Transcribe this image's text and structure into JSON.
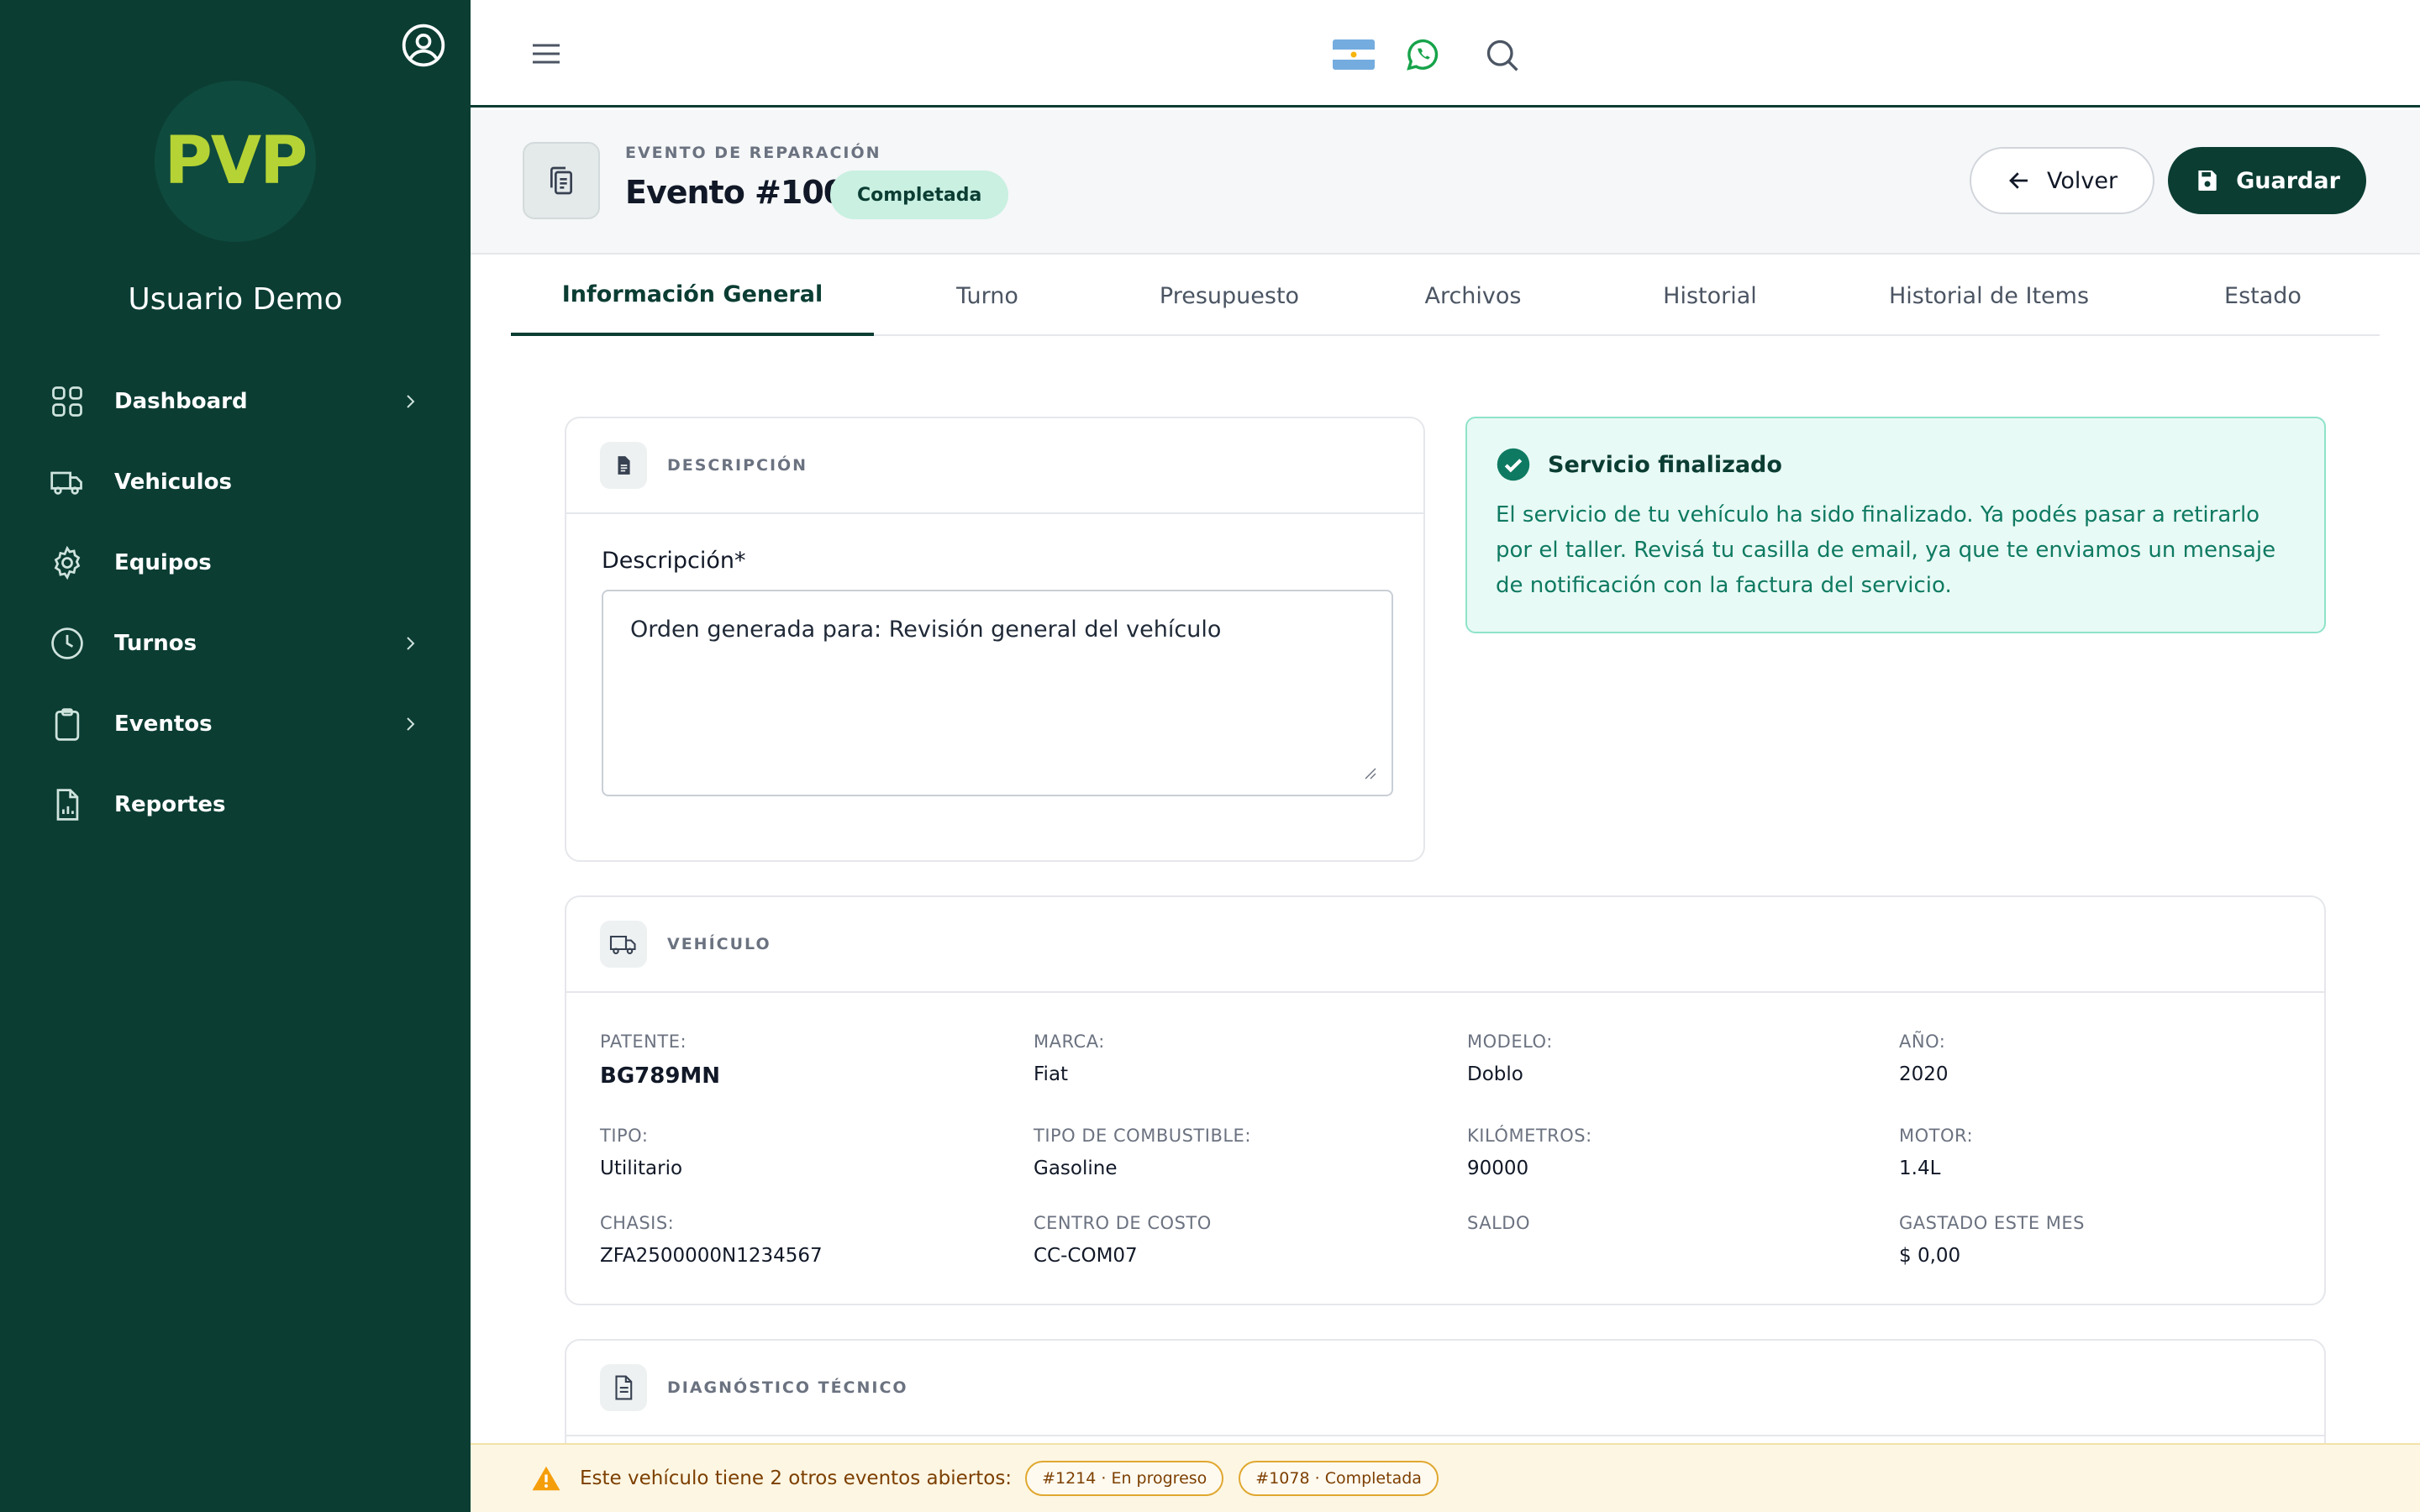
{
  "sidebar": {
    "logo": "PVP",
    "username": "Usuario Demo",
    "items": [
      {
        "label": "Dashboard",
        "icon": "grid-icon",
        "has_chevron": true
      },
      {
        "label": "Vehiculos",
        "icon": "truck-icon",
        "has_chevron": false
      },
      {
        "label": "Equipos",
        "icon": "gear-icon",
        "has_chevron": false
      },
      {
        "label": "Turnos",
        "icon": "clock-icon",
        "has_chevron": true
      },
      {
        "label": "Eventos",
        "icon": "clipboard-icon",
        "has_chevron": true
      },
      {
        "label": "Reportes",
        "icon": "report-icon",
        "has_chevron": false
      }
    ]
  },
  "topbar": {
    "icons": [
      "menu-icon",
      "argentina-flag-icon",
      "whatsapp-icon",
      "search-icon"
    ]
  },
  "header": {
    "eyebrow": "EVENTO DE REPARACIÓN",
    "title": "Evento #1004",
    "status_badge": "Completada",
    "back_label": "Volver",
    "save_label": "Guardar"
  },
  "tabs": [
    {
      "label": "Información General",
      "active": true
    },
    {
      "label": "Turno",
      "active": false
    },
    {
      "label": "Presupuesto",
      "active": false
    },
    {
      "label": "Archivos",
      "active": false
    },
    {
      "label": "Historial",
      "active": false
    },
    {
      "label": "Historial de Items",
      "active": false
    },
    {
      "label": "Estado",
      "active": false
    }
  ],
  "description_card": {
    "title": "DESCRIPCIÓN",
    "field_label": "Descripción*",
    "value": "Orden generada para: Revisión general del vehículo"
  },
  "alert": {
    "title": "Servicio finalizado",
    "body": "El servicio de tu vehículo ha sido finalizado. Ya podés pasar a retirarlo por el taller. Revisá tu casilla de email, ya que te enviamos un mensaje de notificación con la factura del servicio."
  },
  "vehicle_card": {
    "title": "VEHÍCULO",
    "fields": [
      {
        "key": "PATENTE:",
        "value": "BG789MN"
      },
      {
        "key": "MARCA:",
        "value": "Fiat"
      },
      {
        "key": "MODELO:",
        "value": "Doblo"
      },
      {
        "key": "AÑO:",
        "value": "2020"
      },
      {
        "key": "TIPO:",
        "value": "Utilitario"
      },
      {
        "key": "TIPO DE COMBUSTIBLE:",
        "value": "Gasoline"
      },
      {
        "key": "KILÓMETROS:",
        "value": "90000"
      },
      {
        "key": "MOTOR:",
        "value": "1.4L"
      },
      {
        "key": "CHASIS:",
        "value": "ZFA2500000N1234567"
      },
      {
        "key": "CENTRO DE COSTO",
        "value": "CC-COM07"
      },
      {
        "key": "SALDO",
        "value": ""
      },
      {
        "key": "GASTADO ESTE MES",
        "value": "$ 0,00"
      }
    ]
  },
  "diagnostic_card": {
    "title": "DIAGNÓSTICO TÉCNICO"
  },
  "warning": {
    "text": "Este vehículo tiene 2 otros eventos abiertos:",
    "events": [
      "#1214 · En progreso",
      "#1078 · Completada"
    ]
  },
  "colors": {
    "primary": "#0b3d33",
    "logo": "#b5d334",
    "success_bg": "#e8faf5",
    "success_text": "#0f7a62",
    "warning_bg": "#fdf6e3"
  }
}
